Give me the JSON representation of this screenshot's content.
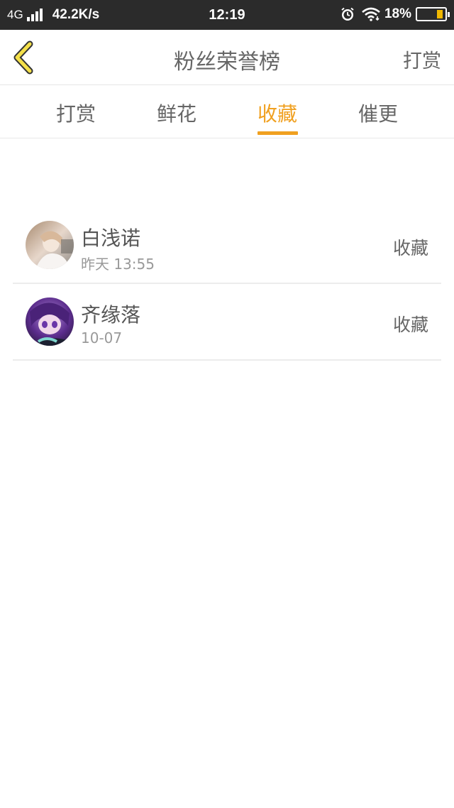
{
  "status_bar": {
    "network": "4G",
    "speed": "42.2K/s",
    "time": "12:19",
    "battery": "18%",
    "icons": [
      "signal-icon",
      "alarm-icon",
      "wifi-icon",
      "battery-icon"
    ]
  },
  "header": {
    "title": "粉丝荣誉榜",
    "action_label": "打赏",
    "back_icon": "chevron-left-icon",
    "accent_color": "#f0a020"
  },
  "tabs": [
    {
      "label": "打赏",
      "active": false
    },
    {
      "label": "鲜花",
      "active": false
    },
    {
      "label": "收藏",
      "active": true
    },
    {
      "label": "催更",
      "active": false
    }
  ],
  "list": [
    {
      "name": "白浅诺",
      "time": "昨天 13:55",
      "action": "收藏"
    },
    {
      "name": "齐缘落",
      "time": "10-07",
      "action": "收藏"
    }
  ]
}
